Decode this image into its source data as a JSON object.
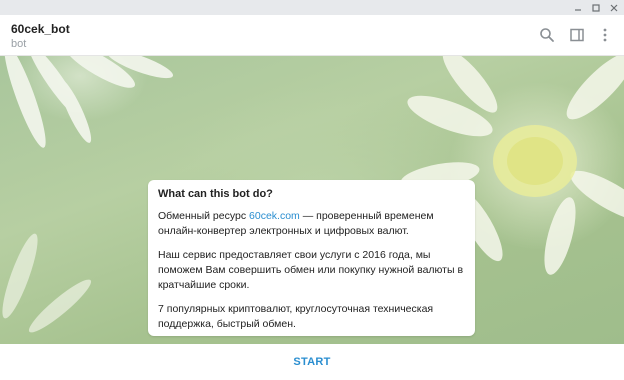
{
  "window": {
    "controls": [
      "minimize-icon",
      "maximize-icon",
      "close-icon"
    ]
  },
  "header": {
    "title": "60cek_bot",
    "subtitle": "bot",
    "icons": [
      "search-icon",
      "sidebar-panel-icon",
      "more-vertical-icon"
    ]
  },
  "card": {
    "title": "What can this bot do?",
    "p1_before": "Обменный ресурс ",
    "p1_link": "60cek.com",
    "p1_after": " — проверенный временем онлайн-конвертер электронных и цифровых валют.",
    "p2": "Наш сервис предоставляет свои услуги с 2016 года, мы поможем Вам совершить обмен или покупку нужной валюты в кратчайшие сроки.",
    "p3": "7 популярных криптовалют, круглосуточная техническая поддержка, быстрый обмен."
  },
  "footer": {
    "start_label": "START"
  },
  "colors": {
    "accent": "#2a8ed0",
    "wallpaper": "#a9c69c"
  }
}
